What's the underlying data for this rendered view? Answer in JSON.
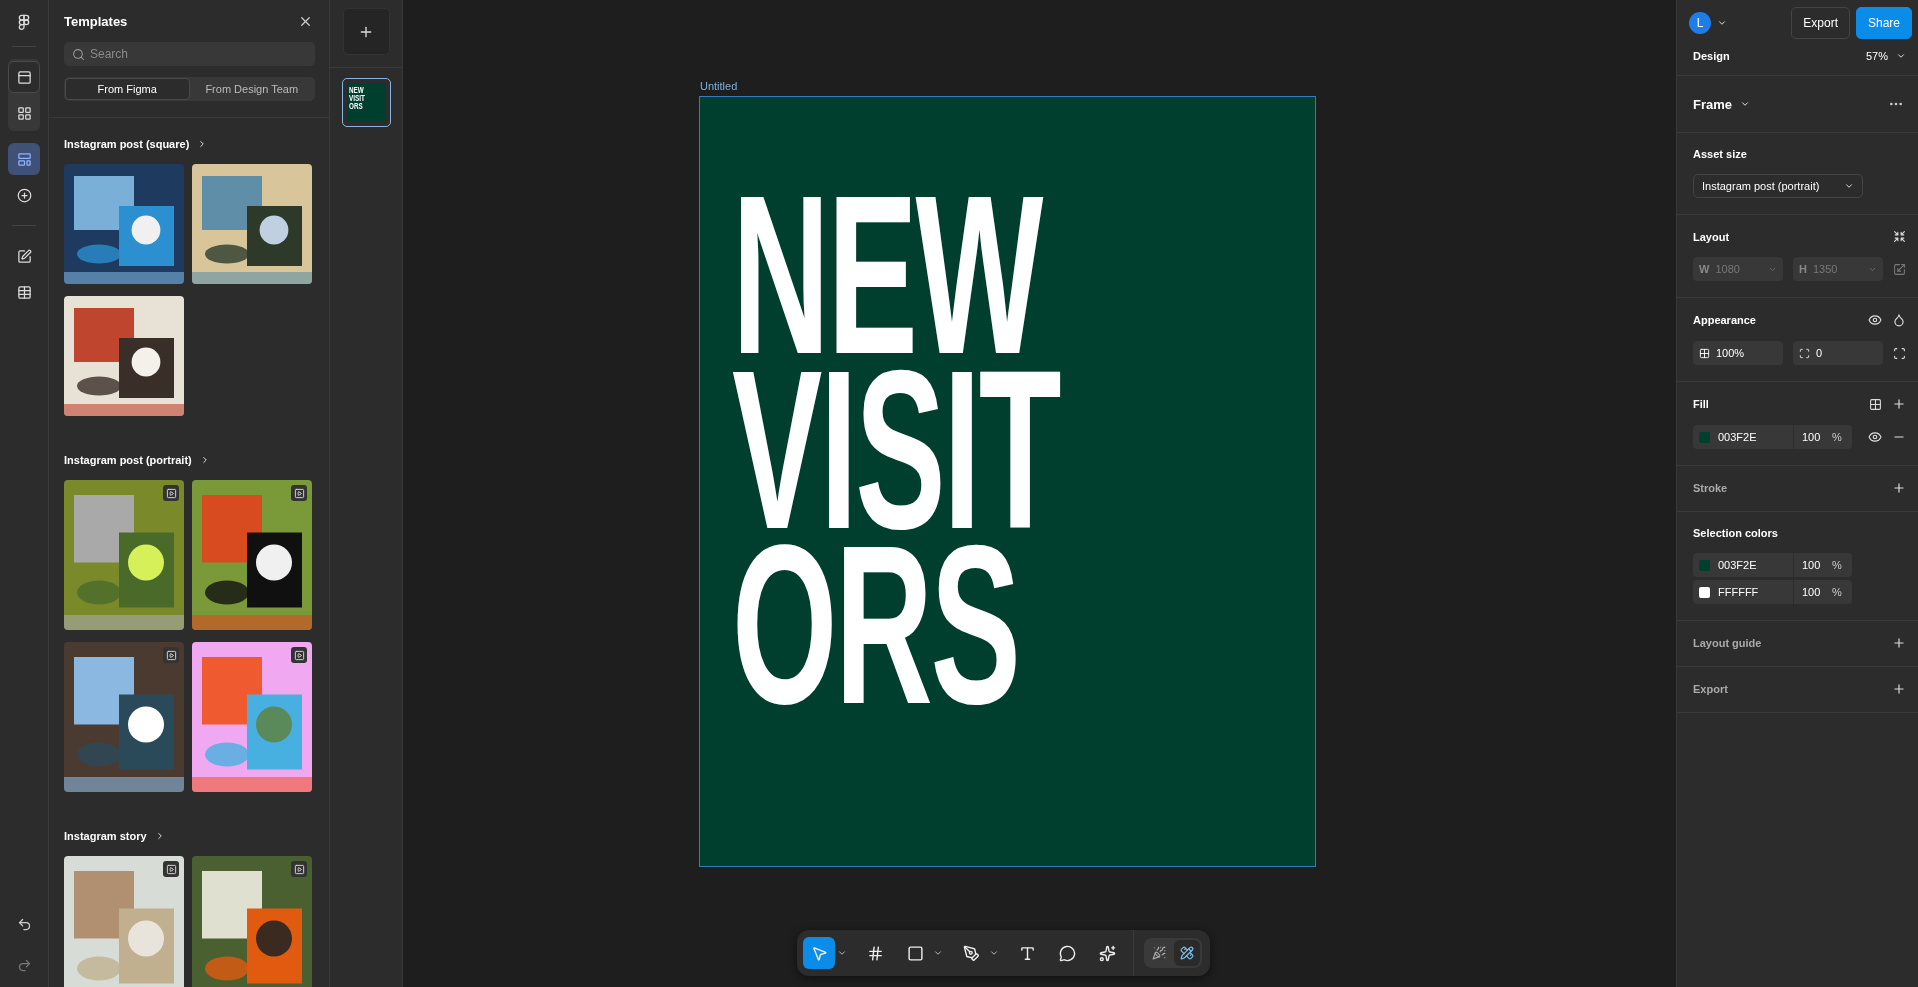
{
  "rail": {
    "group_items": [
      {
        "kind": "layers",
        "selected": true
      },
      {
        "kind": "assets",
        "selected": false
      }
    ],
    "items": [
      {
        "kind": "templates",
        "selected": true
      },
      {
        "kind": "plugins",
        "selected": false
      },
      {
        "kind": "edit",
        "selected": false
      },
      {
        "kind": "table",
        "selected": false
      }
    ]
  },
  "templates_panel": {
    "title": "Templates",
    "search": {
      "placeholder": "Search"
    },
    "tabs": [
      {
        "label": "From Figma",
        "selected": true
      },
      {
        "label": "From Design Team",
        "selected": false
      }
    ],
    "sections": [
      {
        "title": "Instagram post (square)",
        "items": [
          {
            "kind": "picture",
            "video": false
          },
          {
            "kind": "picture",
            "video": false
          },
          {
            "kind": "picture",
            "video": false
          }
        ]
      },
      {
        "title": "Instagram post (portrait)",
        "items": [
          {
            "kind": "picture",
            "video": true
          },
          {
            "kind": "picture",
            "video": true
          },
          {
            "kind": "picture",
            "video": true
          },
          {
            "kind": "picture",
            "video": true
          }
        ]
      },
      {
        "title": "Instagram story",
        "items": [
          {
            "kind": "picture",
            "video": true
          },
          {
            "kind": "picture",
            "video": true
          }
        ]
      }
    ]
  },
  "pages": {
    "thumbnails": [
      {
        "lines": [
          "NEW",
          "VISIT",
          "ORS"
        ],
        "selected": true
      }
    ]
  },
  "canvas": {
    "frame_label": "Untitled",
    "headline": [
      "NEW",
      "VISIT",
      "ORS"
    ]
  },
  "toolbar": {
    "tools": [
      {
        "kind": "move",
        "selected": true,
        "menu": true
      },
      {
        "kind": "frame",
        "selected": false,
        "menu": false
      },
      {
        "kind": "shape",
        "selected": false,
        "menu": true
      },
      {
        "kind": "pen",
        "selected": false,
        "menu": true
      },
      {
        "kind": "text",
        "selected": false,
        "menu": false
      },
      {
        "kind": "comment",
        "selected": false,
        "menu": false
      },
      {
        "kind": "ai",
        "selected": false,
        "menu": false
      }
    ],
    "modes": [
      {
        "kind": "draw",
        "selected": false
      },
      {
        "kind": "design",
        "selected": true
      }
    ]
  },
  "header": {
    "avatar": "L",
    "buttons": [
      {
        "label": "Export",
        "primary": false
      },
      {
        "label": "Share",
        "primary": true
      }
    ]
  },
  "design": {
    "tab": "Design",
    "zoom": "57%"
  },
  "frame": {
    "title": "Frame"
  },
  "asset_size": {
    "title": "Asset size",
    "value": "Instagram post (portrait)"
  },
  "layout": {
    "title": "Layout",
    "fields": [
      {
        "label": "W",
        "value": "1080",
        "disabled": true
      },
      {
        "label": "H",
        "value": "1350",
        "disabled": true
      }
    ]
  },
  "appearance": {
    "title": "Appearance",
    "opacity": "100%",
    "radius": "0"
  },
  "fill": {
    "title": "Fill",
    "items": [
      {
        "hex": "003F2E",
        "opacity": "100",
        "unit": "%",
        "color": "#003f2e"
      }
    ]
  },
  "stroke": {
    "title": "Stroke"
  },
  "selection_colors": {
    "title": "Selection colors",
    "items": [
      {
        "hex": "003F2E",
        "opacity": "100",
        "unit": "%",
        "color": "#003f2e"
      },
      {
        "hex": "FFFFFF",
        "opacity": "100",
        "unit": "%",
        "color": "#ffffff"
      }
    ]
  },
  "layout_guide": {
    "title": "Layout guide"
  },
  "export": {
    "title": "Export"
  }
}
